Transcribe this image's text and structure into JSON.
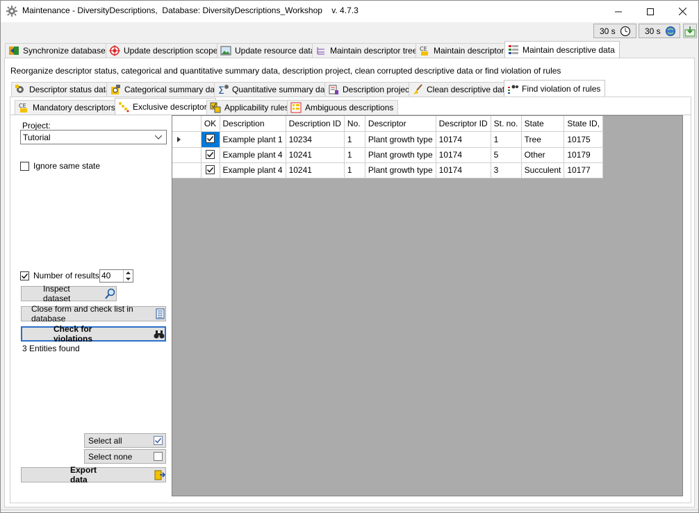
{
  "window": {
    "title": "Maintenance - DiversityDescriptions,  Database: DiversityDescriptions_Workshop    v. 4.7.3",
    "controls": [
      "—",
      "☐",
      "✕"
    ]
  },
  "toolstrip": {
    "timer1": "30 s",
    "timer2": "30 s"
  },
  "main_tabs": [
    {
      "label": "Synchronize databases"
    },
    {
      "label": "Update description scopes"
    },
    {
      "label": "Update resource data"
    },
    {
      "label": "Maintain descriptor trees"
    },
    {
      "label": "Maintain descriptors"
    },
    {
      "label": "Maintain descriptive data"
    }
  ],
  "description_text": "Reorganize descriptor status, categorical and quantitative summary data, description project, clean corrupted descriptive data or find violation of rules",
  "sub_tabs": [
    {
      "label": "Descriptor status data"
    },
    {
      "label": "Categorical summary data"
    },
    {
      "label": "Quantitative summary data"
    },
    {
      "label": "Description project"
    },
    {
      "label": "Clean descriptive data"
    },
    {
      "label": "Find violation of rules"
    }
  ],
  "rule_tabs": [
    {
      "label": "Mandatory descriptors"
    },
    {
      "label": "Exclusive descriptors"
    },
    {
      "label": "Applicability rules"
    },
    {
      "label": "Ambiguous descriptions"
    }
  ],
  "left_panel": {
    "project_label": "Project:",
    "project_value": "Tutorial",
    "ignore_same_state_label": "Ignore same state",
    "ignore_same_state_checked": false,
    "number_of_results_label": "Number of results:",
    "number_of_results_checked": true,
    "number_of_results_value": "40",
    "inspect_dataset_label": "Inspect dataset",
    "close_form_label": "Close form and check list in database",
    "check_violations_label": "Check for violations",
    "status_text": "3 Entities found",
    "select_all_label": "Select all",
    "select_none_label": "Select none",
    "export_data_label": "Export data"
  },
  "grid": {
    "columns": [
      "OK",
      "Description",
      "Description ID",
      "No.",
      "Descriptor",
      "Descriptor ID",
      "St. no.",
      "State",
      "State ID,"
    ],
    "rows": [
      {
        "ok": true,
        "description": "Example plant 1",
        "description_id": "10234",
        "no": "1",
        "descriptor": "Plant growth type",
        "descriptor_id": "10174",
        "st_no": "1",
        "state": "Tree",
        "state_id": "10175"
      },
      {
        "ok": true,
        "description": "Example plant 4",
        "description_id": "10241",
        "no": "1",
        "descriptor": "Plant growth type",
        "descriptor_id": "10174",
        "st_no": "5",
        "state": "Other",
        "state_id": "10179"
      },
      {
        "ok": true,
        "description": "Example plant 4",
        "description_id": "10241",
        "no": "1",
        "descriptor": "Plant growth type",
        "descriptor_id": "10174",
        "st_no": "3",
        "state": "Succulent",
        "state_id": "10177"
      }
    ]
  },
  "colors": {
    "accent": "#0078d7",
    "grid_background": "#ababab",
    "window_background": "#f0f0f0"
  }
}
